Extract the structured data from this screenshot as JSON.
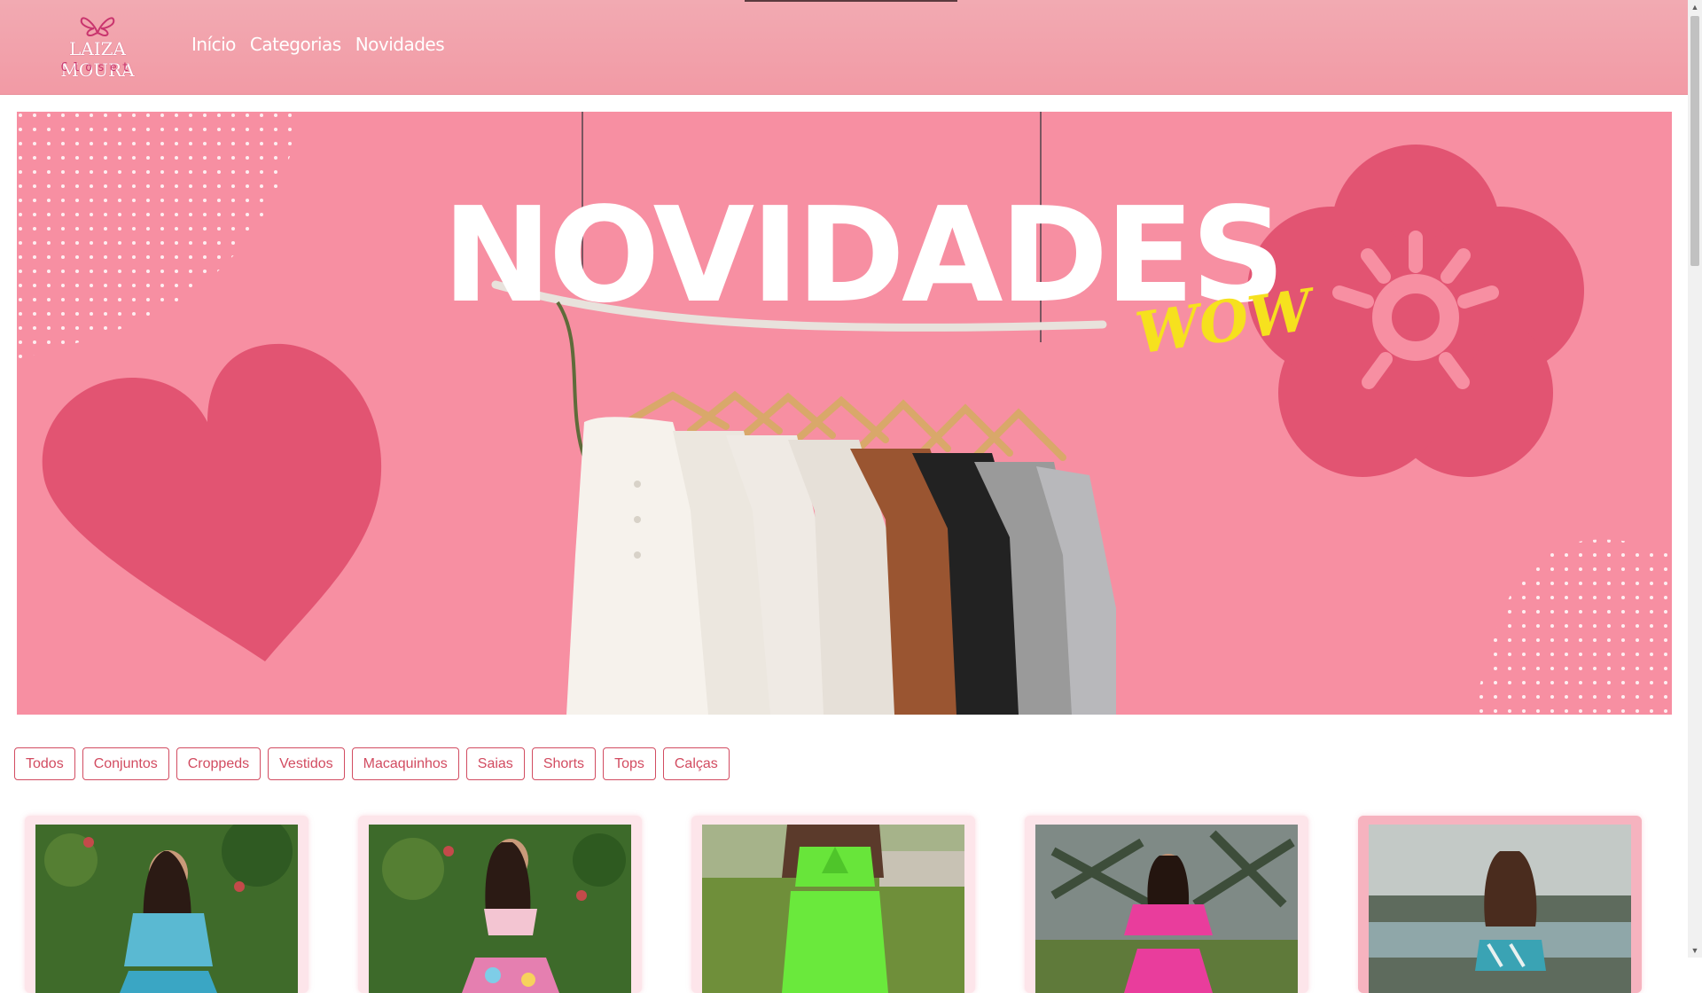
{
  "brand": {
    "name": "LAIZA MOURA",
    "sub": "Closet",
    "logo_icon": "butterfly-icon"
  },
  "nav": [
    {
      "label": "Início"
    },
    {
      "label": "Categorias"
    },
    {
      "label": "Novidades"
    }
  ],
  "banner": {
    "headline": "NOVIDADES",
    "tagline": "WOW",
    "background": "#f78fa2",
    "accent": "#e25472"
  },
  "filters": [
    "Todos",
    "Conjuntos",
    "Croppeds",
    "Vestidos",
    "Macaquinhos",
    "Saias",
    "Shorts",
    "Tops",
    "Calças"
  ],
  "colors": {
    "header": "#f2a3ad",
    "button_border": "#d24c61"
  },
  "products": [
    {
      "image": "woman-floral-turquoise-set-photo"
    },
    {
      "image": "woman-floral-colorful-set-photo"
    },
    {
      "image": "woman-green-jumpsuit-photo"
    },
    {
      "image": "woman-pink-set-photo"
    },
    {
      "image": "woman-turquoise-top-photo"
    }
  ]
}
